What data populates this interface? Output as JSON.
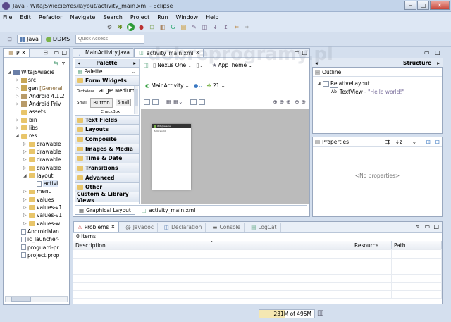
{
  "window": {
    "title": "Java - WitajSwiecie/res/layout/activity_main.xml - Eclipse",
    "minimize": "–",
    "maximize": "□",
    "close": "✕"
  },
  "menu": [
    "File",
    "Edit",
    "Refactor",
    "Navigate",
    "Search",
    "Project",
    "Run",
    "Window",
    "Help"
  ],
  "perspectives": {
    "java": "Java",
    "ddms": "DDMS",
    "quick_access_placeholder": "Quick Access"
  },
  "explorer": {
    "tab_label": "P",
    "items": [
      {
        "label": "WitajSwiecie",
        "depth": 0,
        "kind": "project",
        "arrow": "◢"
      },
      {
        "label": "src",
        "depth": 1,
        "kind": "pkg",
        "arrow": "▷"
      },
      {
        "label": "gen",
        "suffix": "[General",
        "depth": 1,
        "kind": "pkg",
        "arrow": "▷"
      },
      {
        "label": "Android 4.1.2",
        "depth": 1,
        "kind": "lib",
        "arrow": "▷"
      },
      {
        "label": "Android Priv",
        "depth": 1,
        "kind": "lib",
        "arrow": "▷"
      },
      {
        "label": "assets",
        "depth": 1,
        "kind": "folder",
        "arrow": ""
      },
      {
        "label": "bin",
        "depth": 1,
        "kind": "folder",
        "arrow": "▷"
      },
      {
        "label": "libs",
        "depth": 1,
        "kind": "folder",
        "arrow": "▷"
      },
      {
        "label": "res",
        "depth": 1,
        "kind": "folder",
        "arrow": "◢"
      },
      {
        "label": "drawable",
        "depth": 2,
        "kind": "folder",
        "arrow": "▷"
      },
      {
        "label": "drawable",
        "depth": 2,
        "kind": "folder",
        "arrow": "▷"
      },
      {
        "label": "drawable",
        "depth": 2,
        "kind": "folder",
        "arrow": "▷"
      },
      {
        "label": "drawable",
        "depth": 2,
        "kind": "folder",
        "arrow": "▷"
      },
      {
        "label": "layout",
        "depth": 2,
        "kind": "folder",
        "arrow": "◢"
      },
      {
        "label": "activi",
        "depth": 3,
        "kind": "file",
        "arrow": ""
      },
      {
        "label": "menu",
        "depth": 2,
        "kind": "folder",
        "arrow": "▷"
      },
      {
        "label": "values",
        "depth": 2,
        "kind": "folder",
        "arrow": "▷"
      },
      {
        "label": "values-v1",
        "depth": 2,
        "kind": "folder",
        "arrow": "▷"
      },
      {
        "label": "values-v1",
        "depth": 2,
        "kind": "folder",
        "arrow": "▷"
      },
      {
        "label": "values-w",
        "depth": 2,
        "kind": "folder",
        "arrow": "▷"
      },
      {
        "label": "AndroidMan",
        "depth": 1,
        "kind": "file",
        "arrow": ""
      },
      {
        "label": "ic_launcher-",
        "depth": 1,
        "kind": "file",
        "arrow": ""
      },
      {
        "label": "proguard-pr",
        "depth": 1,
        "kind": "file",
        "arrow": ""
      },
      {
        "label": "project.prop",
        "depth": 1,
        "kind": "file",
        "arrow": ""
      }
    ]
  },
  "editor": {
    "tabs": [
      {
        "label": "MainActivity.java"
      },
      {
        "label": "activity_main.xml",
        "close": "✕"
      }
    ],
    "palette_title": "Palette",
    "palette_dropdown": "Palette",
    "form_widgets": "Form Widgets",
    "widgets": {
      "textview": "TextView",
      "large": "Large",
      "medium": "Medium",
      "small": "Small",
      "button": "Button",
      "small_button": "Small",
      "checkbox": "CheckBox"
    },
    "categories": [
      "Text Fields",
      "Layouts",
      "Composite",
      "Images & Media",
      "Time & Date",
      "Transitions",
      "Advanced",
      "Other",
      "Custom & Library Views"
    ],
    "device": "Nexus One",
    "theme": "AppTheme",
    "activity": "MainActivity",
    "api": "21",
    "phone_app_name": "WitajSwiecie",
    "phone_text": "Hello world!",
    "bottom_tabs": [
      "Graphical Layout",
      "activity_main.xml"
    ]
  },
  "structure": {
    "title": "Structure"
  },
  "outline": {
    "title": "Outline",
    "root": "RelativeLayout",
    "child": "TextView",
    "child_value": "- \"Hello world!\""
  },
  "properties": {
    "title": "Properties",
    "empty": "<No properties>"
  },
  "bottom": {
    "tabs": [
      "Problems",
      "Javadoc",
      "Declaration",
      "Console",
      "LogCat"
    ],
    "count": "0 items",
    "columns": [
      "Description",
      "Resource",
      "Path"
    ]
  },
  "status": {
    "memory": "231M of 495M"
  },
  "watermark": "dobreprogramy.pl"
}
